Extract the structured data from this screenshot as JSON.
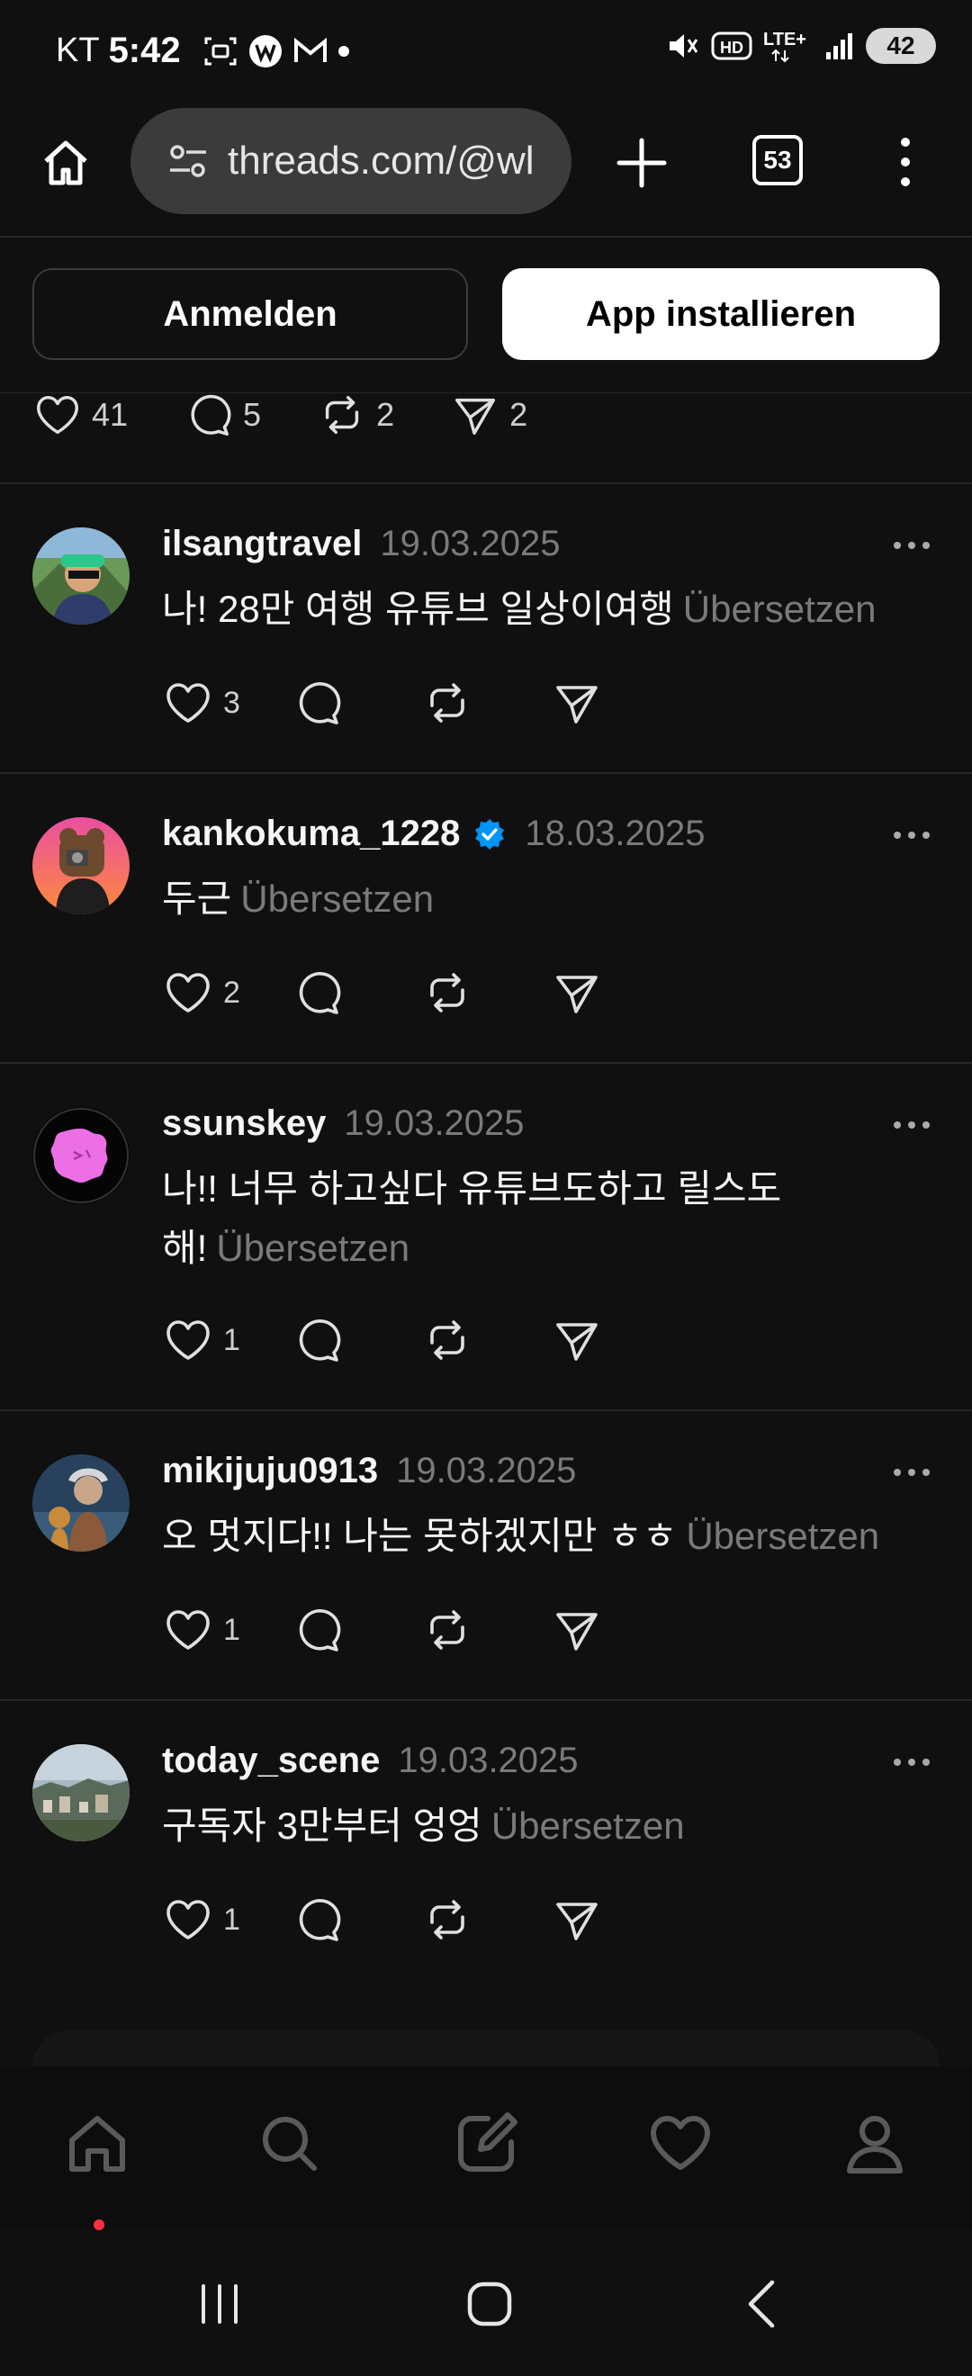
{
  "status_bar": {
    "carrier": "KT",
    "time": "5:42",
    "network": "LTE+",
    "hd": "HD",
    "battery": "42"
  },
  "browser": {
    "url": "threads.com/@wl",
    "tab_count": "53"
  },
  "auth": {
    "login_label": "Anmelden",
    "install_label": "App installieren"
  },
  "top_stats": {
    "likes": "41",
    "replies": "5",
    "reposts": "2",
    "shares": "2"
  },
  "translate_label": "Übersetzen",
  "posts": [
    {
      "username": "ilsangtravel",
      "date": "19.03.2025",
      "text": "나! 28만 여행 유튜브 일상이여행",
      "likes": "3",
      "verified": false
    },
    {
      "username": "kankokuma_1228",
      "date": "18.03.2025",
      "text": "두근",
      "likes": "2",
      "verified": true
    },
    {
      "username": "ssunskey",
      "date": "19.03.2025",
      "text": "나!! 너무 하고싶다 유튜브도하고 릴스도 해!",
      "likes": "1",
      "verified": false
    },
    {
      "username": "mikijuju0913",
      "date": "19.03.2025",
      "text": "오 멋지다!! 나는 못하겠지만 ㅎㅎ",
      "likes": "1",
      "verified": false
    },
    {
      "username": "today_scene",
      "date": "19.03.2025",
      "text": "구독자 3만부터 엉엉",
      "likes": "1",
      "verified": false
    }
  ],
  "colors": {
    "background": "#101010",
    "verified_badge": "#0095f6",
    "muted_text": "#7a7a7a",
    "active_dot": "#ff3040"
  },
  "nav_icons": [
    "home-icon",
    "search-icon",
    "compose-icon",
    "activity-heart-icon",
    "profile-icon"
  ]
}
